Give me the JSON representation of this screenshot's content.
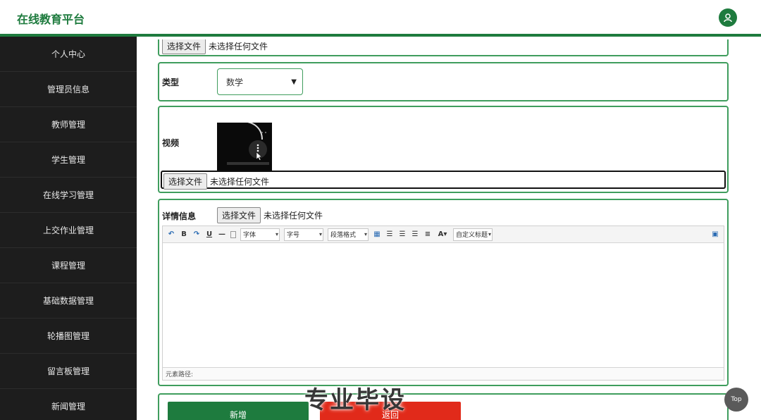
{
  "header": {
    "title": "在线教育平台",
    "avatar_icon": "user-icon",
    "accent": "#1e7b3e"
  },
  "sidebar": {
    "items": [
      {
        "label": "个人中心"
      },
      {
        "label": "管理员信息"
      },
      {
        "label": "教师管理"
      },
      {
        "label": "学生管理"
      },
      {
        "label": "在线学习管理"
      },
      {
        "label": "上交作业管理"
      },
      {
        "label": "课程管理"
      },
      {
        "label": "基础数据管理"
      },
      {
        "label": "轮播图管理"
      },
      {
        "label": "留言板管理"
      },
      {
        "label": "新闻管理"
      }
    ]
  },
  "form": {
    "file_button_label": "选择文件",
    "no_file_text": "未选择任何文件",
    "type_label": "类型",
    "type_value": "数学",
    "video_label": "视频",
    "detail_label": "详情信息",
    "editor": {
      "font_select": "字体",
      "size_select": "字号",
      "paragraph_select": "段落格式",
      "custom_title_select": "自定义标题",
      "status_path": "元素路径:"
    },
    "submit_label": "新增",
    "back_label": "返回"
  },
  "overlay": {
    "watermark": "专业毕设",
    "top_button": "Top"
  }
}
